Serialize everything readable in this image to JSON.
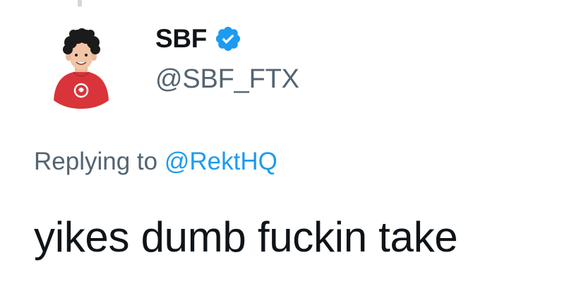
{
  "tweet": {
    "author": {
      "display_name": "SBF",
      "handle": "@SBF_FTX",
      "avatar_icon": "avatar-cartoon-portrait",
      "verified_icon": "verified-badge-icon"
    },
    "reply_prefix": "Replying to",
    "reply_target": "@RektHQ",
    "text": "yikes dumb fuckin take"
  },
  "colors": {
    "text_primary": "#0f1419",
    "text_secondary": "#536471",
    "accent": "#1d9bf0",
    "thread_line": "#cfd9de"
  }
}
